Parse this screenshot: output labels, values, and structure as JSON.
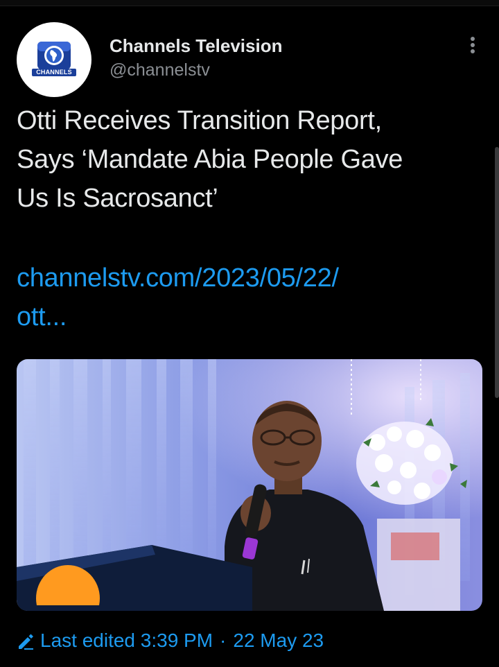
{
  "tweet": {
    "author": {
      "display_name": "Channels Television",
      "handle": "@channelstv",
      "avatar_logo_text": "CHANNELS"
    },
    "more_icon": "more-vertical-icon",
    "text_lines": [
      "Otti Receives Transition Report,",
      "Says ‘Mandate Abia People Gave",
      "Us Is Sacrosanct’"
    ],
    "link_lines": [
      "channelstv.com/2023/05/22/",
      "ott..."
    ],
    "media": {
      "kind": "photo"
    },
    "edited": {
      "icon": "pencil-icon",
      "label": "Last edited 3:39 PM",
      "separator": "·",
      "date": "22 May 23"
    }
  },
  "colors": {
    "background": "#000000",
    "text": "#e7e9ea",
    "secondary_text": "#8b8f94",
    "link": "#1d9bf0",
    "logo_blue": "#1b3f9a"
  }
}
